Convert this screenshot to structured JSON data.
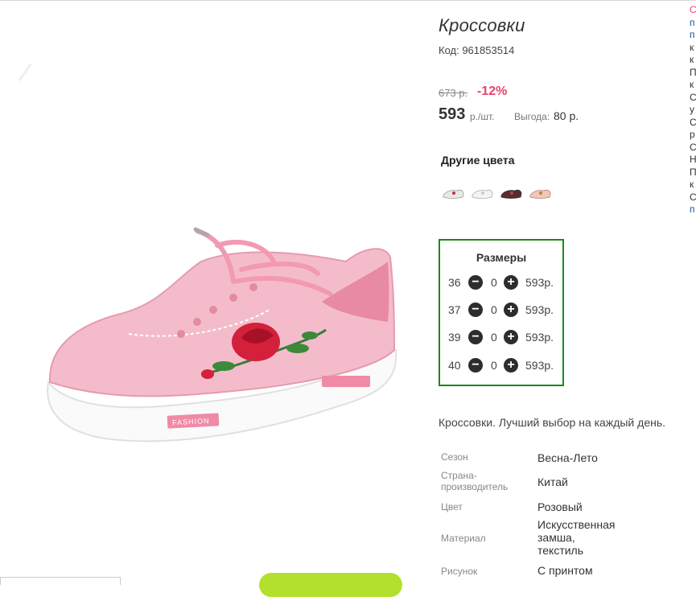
{
  "product": {
    "title": "Кроссовки",
    "code": "Код: 961853514",
    "old_price": "673 р.",
    "discount": "-12%",
    "price": "593",
    "price_unit": "р./шт.",
    "benefit_label": "Выгода:",
    "benefit_value": "80 р."
  },
  "other_colors": {
    "title": "Другие цвета",
    "swatches": [
      {
        "name": "white-red",
        "color": "#e8e8e8",
        "accent": "#c0303a"
      },
      {
        "name": "white",
        "color": "#f4f4f4",
        "accent": "#cccccc"
      },
      {
        "name": "dark",
        "color": "#5a2d2d",
        "accent": "#a05050"
      },
      {
        "name": "pink-gold",
        "color": "#f0c8b8",
        "accent": "#c08040"
      }
    ]
  },
  "sizes": {
    "title": "Размеры",
    "rows": [
      {
        "size": "36",
        "qty": "0",
        "price": "593р."
      },
      {
        "size": "37",
        "qty": "0",
        "price": "593р."
      },
      {
        "size": "39",
        "qty": "0",
        "price": "593р."
      },
      {
        "size": "40",
        "qty": "0",
        "price": "593р."
      }
    ],
    "border_color": "#1a8a1a"
  },
  "description": "Кроссовки. Лучший выбор на каждый день.",
  "specs": [
    {
      "key": "Сезон",
      "value": "Весна-Лето"
    },
    {
      "key": "Страна-\nпроизводитель",
      "value": "Китай"
    },
    {
      "key": "Цвет",
      "value": "Розовый"
    },
    {
      "key": "Материал",
      "value": "Искусственная\nзамша,\nтекстиль"
    },
    {
      "key": "Рисунок",
      "value": "С принтом"
    }
  ],
  "right_strip": [
    {
      "text": "С",
      "color": "#e8436c"
    },
    {
      "text": "п",
      "color": "#1a4fa0"
    },
    {
      "text": "п",
      "color": "#1a4fa0"
    },
    {
      "text": "к",
      "color": "#333333"
    },
    {
      "text": "к",
      "color": "#333333"
    },
    {
      "text": "П",
      "color": "#333333"
    },
    {
      "text": "к",
      "color": "#333333"
    },
    {
      "text": "С",
      "color": "#333333"
    },
    {
      "text": "у",
      "color": "#333333"
    },
    {
      "text": "С",
      "color": "#333333"
    },
    {
      "text": "р",
      "color": "#333333"
    },
    {
      "text": "С",
      "color": "#333333"
    },
    {
      "text": "Н",
      "color": "#333333"
    },
    {
      "text": "П",
      "color": "#333333"
    },
    {
      "text": "к",
      "color": "#333333"
    },
    {
      "text": "С",
      "color": "#333333"
    },
    {
      "text": "п",
      "color": "#1a4fa0"
    }
  ],
  "icons": {
    "minus": "minus-circle-icon",
    "plus": "plus-circle-icon"
  },
  "colors": {
    "discount": "#e8436c",
    "shoe_pink": "#f2b6c4",
    "accent_green": "#b3e02e"
  }
}
